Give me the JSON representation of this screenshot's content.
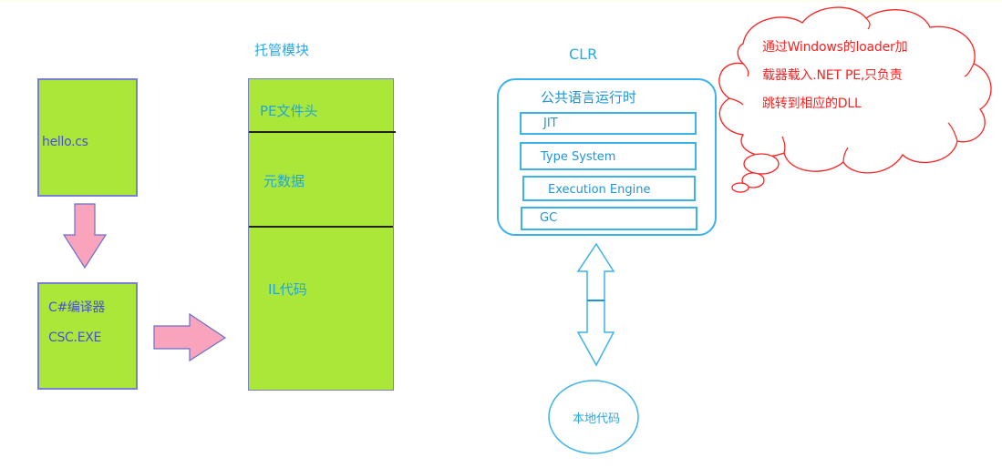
{
  "source_stage": {
    "source_file_label": "hello.cs",
    "compiler_line1": "C#编译器",
    "compiler_line2": "CSC.EXE"
  },
  "managed_module": {
    "title": "托管模块",
    "sections": [
      {
        "label": "PE文件头"
      },
      {
        "label": "元数据"
      },
      {
        "label": "IL代码"
      }
    ]
  },
  "clr": {
    "title": "CLR",
    "runtime_label": "公共语言运行时",
    "components": [
      {
        "label": "JIT"
      },
      {
        "label": "Type System"
      },
      {
        "label": "Execution Engine"
      },
      {
        "label": "GC"
      }
    ],
    "native_code_label": "本地代码"
  },
  "thought_bubble": {
    "lines": [
      "通过Windows的loader加",
      "载器载入.NET PE,只负责",
      "跳转到相应的DLL"
    ]
  },
  "colors": {
    "box_fill": "#abe738",
    "box_border": "#7a7fd6",
    "arrow_fill": "#f9a3bd",
    "clr_stroke": "#3bb3ea",
    "cloud_stroke": "#ff1f1f"
  }
}
